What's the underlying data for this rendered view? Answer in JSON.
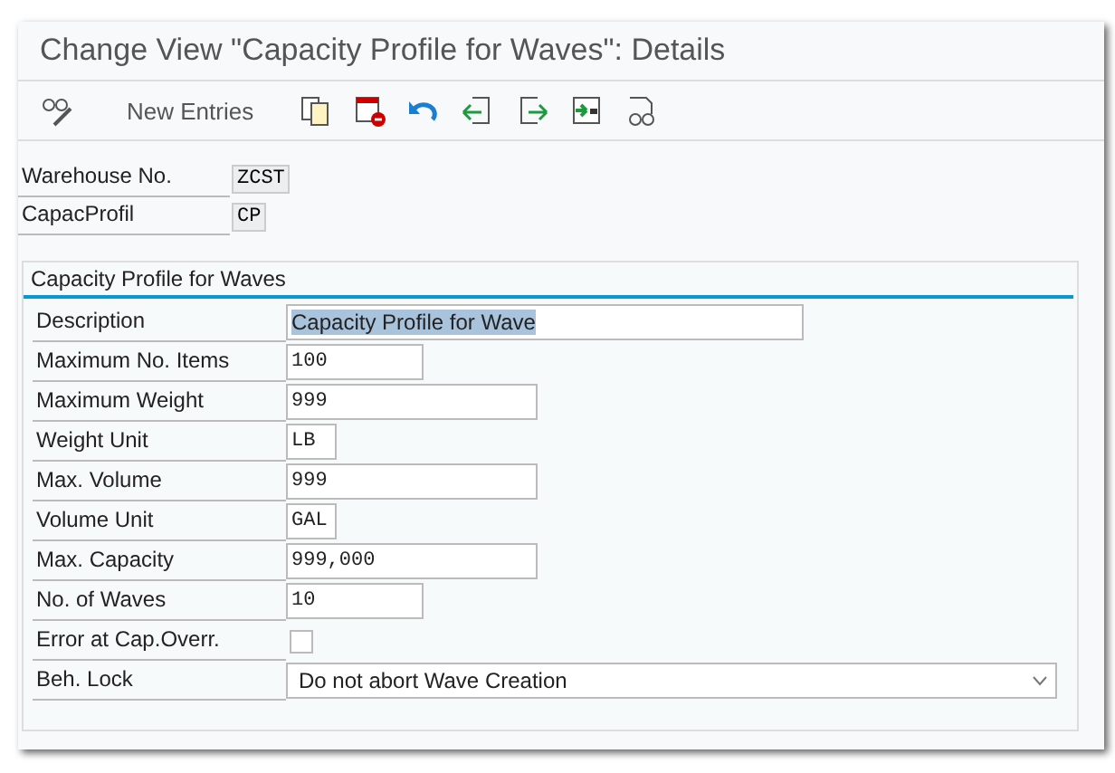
{
  "window": {
    "title": "Change View \"Capacity Profile for Waves\": Details"
  },
  "toolbar": {
    "new_entries": "New Entries"
  },
  "header_fields": [
    {
      "label": "Warehouse No.",
      "value": "ZCST"
    },
    {
      "label": "CapacProfil",
      "value": "CP"
    }
  ],
  "group": {
    "title": "Capacity Profile for Waves",
    "fields": [
      {
        "kind": "text",
        "label": "Description",
        "value": "Capacity Profile for Wave",
        "selected": true
      },
      {
        "kind": "text",
        "label": "Maximum No. Items",
        "value": "100",
        "selected": false
      },
      {
        "kind": "text",
        "label": "Maximum Weight",
        "value": "999",
        "selected": false
      },
      {
        "kind": "text",
        "label": "Weight Unit",
        "value": "LB",
        "selected": false
      },
      {
        "kind": "text",
        "label": "Max. Volume",
        "value": "999",
        "selected": false
      },
      {
        "kind": "text",
        "label": "Volume Unit",
        "value": "GAL",
        "selected": false
      },
      {
        "kind": "text",
        "label": "Max. Capacity",
        "value": "999,000",
        "selected": false
      },
      {
        "kind": "text",
        "label": "No. of Waves",
        "value": "10",
        "selected": false
      },
      {
        "kind": "checkbox",
        "label": "Error at Cap.Overr.",
        "checked": false
      },
      {
        "kind": "dropdown",
        "label": "Beh. Lock",
        "value": "Do not abort Wave Creation"
      }
    ]
  }
}
